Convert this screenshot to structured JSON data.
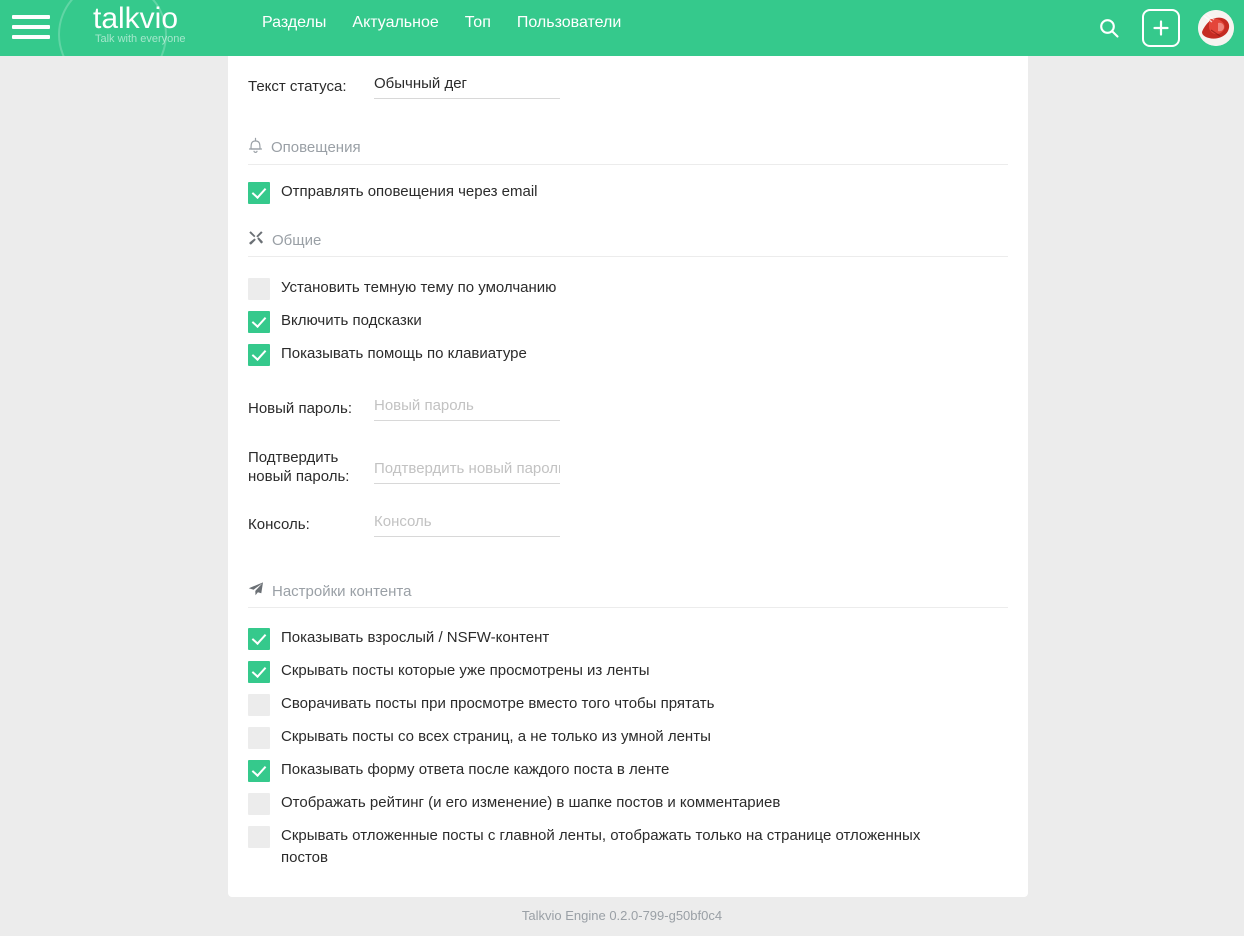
{
  "header": {
    "logo_title": "talkvio",
    "logo_tagline": "Talk with everyone",
    "menu_icon": "hamburger-icon",
    "nav": [
      {
        "label": "Разделы"
      },
      {
        "label": "Актуальное"
      },
      {
        "label": "Топ"
      },
      {
        "label": "Пользователи"
      }
    ],
    "search_icon": "search-icon",
    "create_icon": "plus-icon",
    "avatar_icon": "user-avatar",
    "accent_color": "#35c98c"
  },
  "form": {
    "status": {
      "label": "Текст статуса:",
      "value": "Обычный дег",
      "placeholder": ""
    },
    "new_password": {
      "label": "Новый пароль:",
      "value": "",
      "placeholder": "Новый пароль"
    },
    "confirm_password": {
      "label": "Подтвердить новый пароль:",
      "value": "",
      "placeholder": "Подтвердить новый пароль"
    },
    "console": {
      "label": "Консоль:",
      "value": "",
      "placeholder": "Консоль"
    }
  },
  "sections": {
    "notifications": {
      "title": "Оповещения",
      "icon": "bell-icon",
      "items": [
        {
          "label": "Отправлять оповещения через email",
          "checked": true
        }
      ]
    },
    "general": {
      "title": "Общие",
      "icon": "tools-icon",
      "items": [
        {
          "label": "Установить темную тему по умолчанию",
          "checked": false
        },
        {
          "label": "Включить подсказки",
          "checked": true
        },
        {
          "label": "Показывать помощь по клавиатуре",
          "checked": true
        }
      ]
    },
    "content": {
      "title": "Настройки контента",
      "icon": "paper-plane-icon",
      "items": [
        {
          "label": "Показывать взрослый / NSFW-контент",
          "checked": true
        },
        {
          "label": "Скрывать посты которые уже просмотрены из ленты",
          "checked": true
        },
        {
          "label": "Сворачивать посты при просмотре вместо того чтобы прятать",
          "checked": false
        },
        {
          "label": "Скрывать посты со всех страниц, а не только из умной ленты",
          "checked": false
        },
        {
          "label": "Показывать форму ответа после каждого поста в ленте",
          "checked": true
        },
        {
          "label": "Отображать рейтинг (и его изменение) в шапке постов и комментариев",
          "checked": false
        },
        {
          "label": "Скрывать отложенные посты с главной ленты, отображать только на странице отложенных постов",
          "checked": false
        }
      ]
    }
  },
  "footer": {
    "text": "Talkvio Engine 0.2.0-799-g50bf0c4"
  }
}
